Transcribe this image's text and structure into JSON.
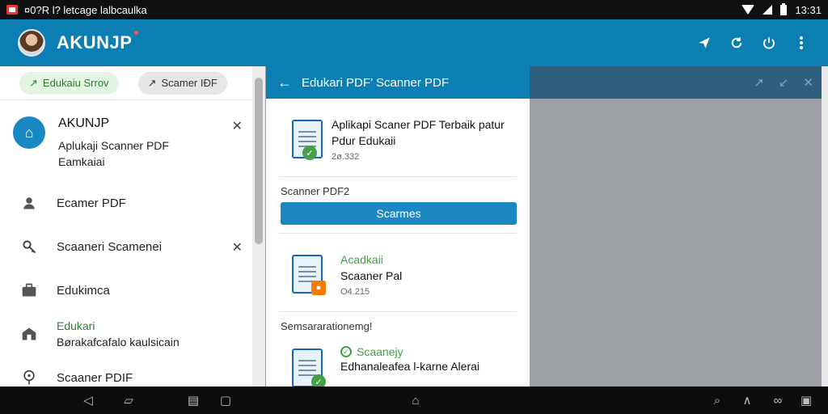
{
  "status_bar": {
    "left_text": "¤0?R l? letcage lalbcaulka",
    "time": "13:31"
  },
  "app_bar": {
    "title": "AKUNJP"
  },
  "left_panel": {
    "chips": [
      {
        "label": "Edukaiu Srrov"
      },
      {
        "label": "Scamer IĐF"
      }
    ],
    "profile": {
      "name": "AKUNJP",
      "line1": "Aplukaji Scanner PDF",
      "line2": "Eamkaiai"
    },
    "menu": [
      {
        "label": "Ecamer PDF"
      },
      {
        "label": "Scaaneri Scamenei"
      },
      {
        "label": "Edukimca"
      },
      {
        "label_green": "Edukari",
        "label": "Børakafcafalo kaulsicain"
      },
      {
        "label": "Scaaner PDIF"
      }
    ]
  },
  "middle_panel": {
    "header": "Edukari PDF’ Scanner PDF",
    "doc1": {
      "title": "Aplikapi Scaner PDF Terbaik patur Pdur Edukaii",
      "meta": "2ø.332"
    },
    "section1_label": "Scanner PDF2",
    "primary_button": "Scarmes",
    "doc2": {
      "title_green": "Acadkaii",
      "title": "Scaaner Pal",
      "meta": "O4.215"
    },
    "section2_label": "Semsararationemg!",
    "doc3": {
      "title_green": "Scaanejy",
      "title": "Edhanaleafea l-karne Alerai"
    }
  },
  "icons": {
    "status": [
      "app-notification-icon",
      "wifi-icon",
      "signal-icon",
      "battery-icon"
    ],
    "app_bar": [
      "send-icon",
      "refresh-icon",
      "power-icon",
      "more-vert-icon"
    ],
    "nav": [
      "back-icon",
      "recents-icon",
      "keyboard-icon",
      "square-icon",
      "home-icon",
      "search-icon",
      "up-chevron-icon",
      "infinity-icon",
      "overview-icon"
    ]
  },
  "colors": {
    "primary": "#0b7fb3",
    "accent_green": "#43a047",
    "dim": "#9c9fa3"
  }
}
